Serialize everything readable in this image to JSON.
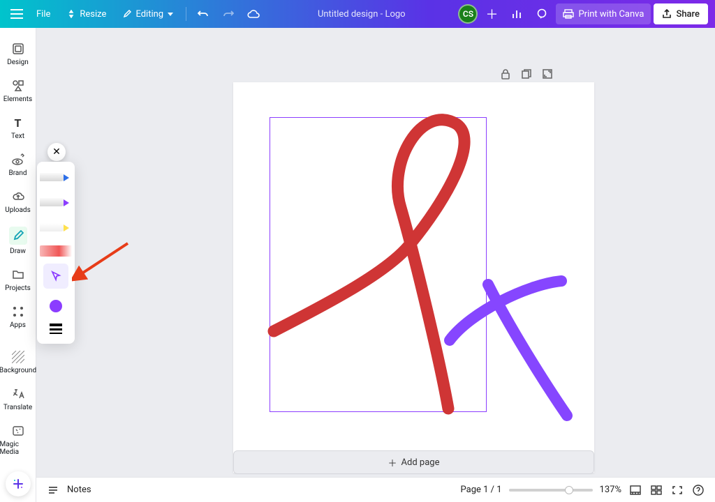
{
  "topbar": {
    "file": "File",
    "resize": "Resize",
    "editing": "Editing",
    "title": "Untitled design - Logo",
    "avatar": "CS",
    "print": "Print with Canva",
    "share": "Share"
  },
  "nav": {
    "design": "Design",
    "elements": "Elements",
    "text": "Text",
    "brand": "Brand",
    "uploads": "Uploads",
    "draw": "Draw",
    "projects": "Projects",
    "apps": "Apps",
    "background": "Background",
    "translate": "Translate",
    "magic_media": "Magic Media"
  },
  "draw_panel": {
    "pen_colors": [
      "#2d6fe8",
      "#8b3dff",
      "#ffe14d"
    ],
    "selected_color": "#8b3dff"
  },
  "canvas": {
    "add_page": "Add page"
  },
  "bottom": {
    "notes": "Notes",
    "page_label": "Page 1 / 1",
    "zoom": "137%"
  }
}
